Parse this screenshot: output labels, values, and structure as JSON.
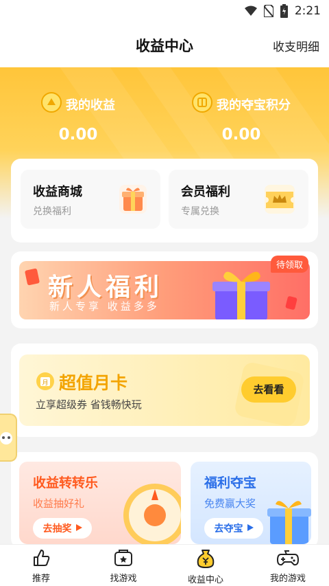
{
  "status": {
    "time": "2:21"
  },
  "header": {
    "title": "收益中心",
    "detail_link": "收支明细"
  },
  "stats": [
    {
      "label": "我的收益",
      "value": "0.00"
    },
    {
      "label": "我的夺宝积分",
      "value": "0.00"
    }
  ],
  "shortcuts": [
    {
      "title": "收益商城",
      "subtitle": "兑换福利"
    },
    {
      "title": "会员福利",
      "subtitle": "专属兑换"
    }
  ],
  "newbie_banner": {
    "title": "新人福利",
    "subtitle": "新人专享 收益多多",
    "badge": "待领取"
  },
  "monthly_card": {
    "icon_text": "月",
    "title": "超值月卡",
    "subtitle": "立享超级券 省钱畅快玩",
    "button": "去看看"
  },
  "promos": [
    {
      "title": "收益转转乐",
      "subtitle": "收益抽好礼",
      "button": "去抽奖"
    },
    {
      "title": "福利夺宝",
      "subtitle": "免费赢大奖",
      "button": "去夺宝"
    }
  ],
  "tabs": [
    {
      "label": "推荐"
    },
    {
      "label": "找游戏"
    },
    {
      "label": "收益中心"
    },
    {
      "label": "我的游戏"
    }
  ],
  "colors": {
    "accent": "#ffcc2e",
    "orange_text": "#ff5a1f",
    "blue_text": "#2a6ee8"
  }
}
